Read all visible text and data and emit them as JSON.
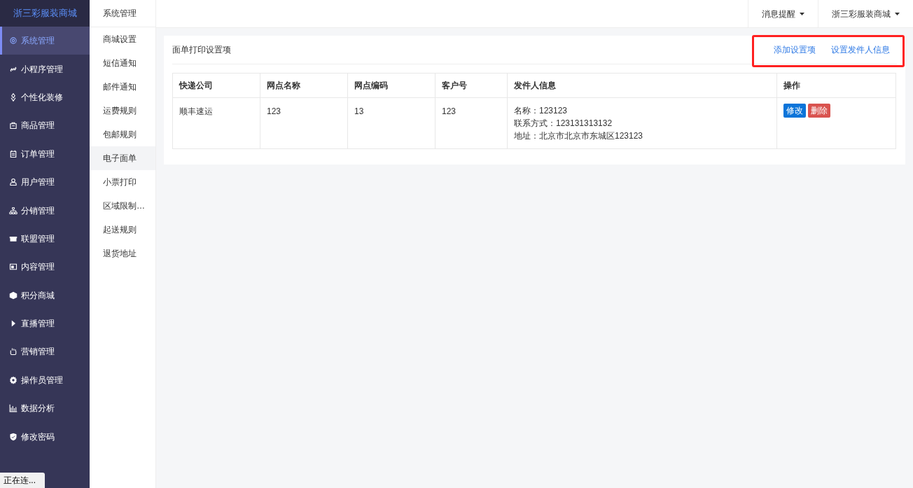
{
  "brand": "浙三彩服装商城",
  "sidebar": {
    "items": [
      {
        "label": "系统管理",
        "selected": true
      },
      {
        "label": "小程序管理",
        "selected": false
      },
      {
        "label": "个性化装修",
        "selected": false
      },
      {
        "label": "商品管理",
        "selected": false
      },
      {
        "label": "订单管理",
        "selected": false
      },
      {
        "label": "用户管理",
        "selected": false
      },
      {
        "label": "分销管理",
        "selected": false
      },
      {
        "label": "联盟管理",
        "selected": false
      },
      {
        "label": "内容管理",
        "selected": false
      },
      {
        "label": "积分商城",
        "selected": false
      },
      {
        "label": "直播管理",
        "selected": false
      },
      {
        "label": "营销管理",
        "selected": false
      },
      {
        "label": "操作员管理",
        "selected": false
      },
      {
        "label": "数据分析",
        "selected": false
      },
      {
        "label": "修改密码",
        "selected": false
      }
    ]
  },
  "submenu": {
    "title": "系统管理",
    "items": [
      {
        "label": "商城设置",
        "selected": false
      },
      {
        "label": "短信通知",
        "selected": false
      },
      {
        "label": "邮件通知",
        "selected": false
      },
      {
        "label": "运费规则",
        "selected": false
      },
      {
        "label": "包邮规则",
        "selected": false
      },
      {
        "label": "电子面单",
        "selected": true
      },
      {
        "label": "小票打印",
        "selected": false
      },
      {
        "label": "区域限制…",
        "selected": false
      },
      {
        "label": "起送规则",
        "selected": false
      },
      {
        "label": "退货地址",
        "selected": false
      }
    ]
  },
  "topbar": {
    "menus": [
      "消息提醒",
      "浙三彩服装商城"
    ]
  },
  "panel": {
    "title": "面单打印设置项",
    "links": [
      "添加设置项",
      "设置发件人信息"
    ],
    "table": {
      "columns": [
        "快递公司",
        "网点名称",
        "网点编码",
        "客户号",
        "发件人信息",
        "操作"
      ],
      "rows": [
        {
          "cells": [
            "顺丰速运",
            "123",
            "13",
            "123"
          ],
          "sender": [
            "名称：123123",
            "联系方式：123131313132",
            "地址：北京市北京市东城区123123"
          ],
          "actions": [
            {
              "label": "修改",
              "kind": "edit"
            },
            {
              "label": "删除",
              "kind": "delete"
            }
          ]
        }
      ]
    }
  },
  "status_tooltip": "正在连..."
}
